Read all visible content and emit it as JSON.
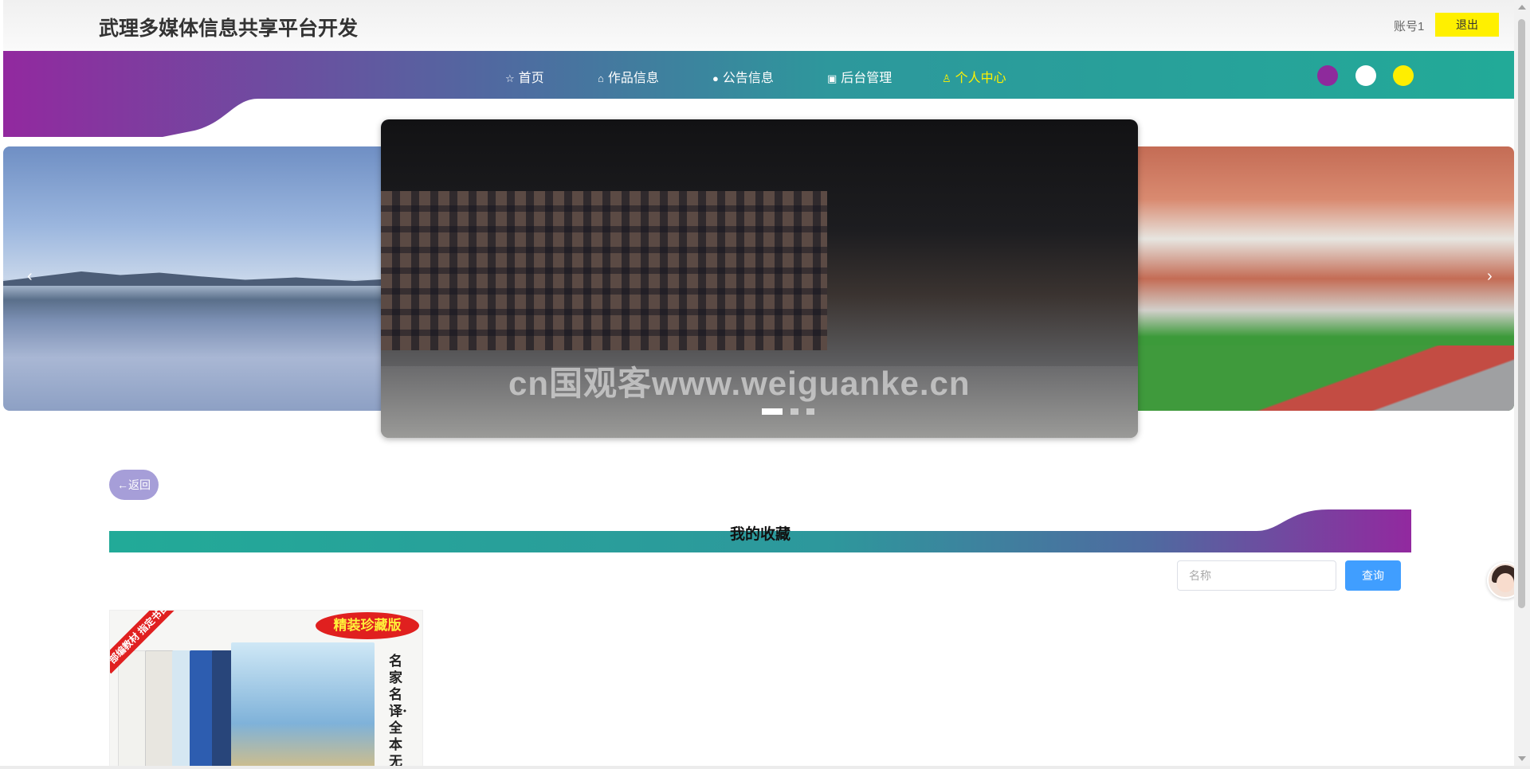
{
  "header": {
    "title": "武理多媒体信息共享平台开发",
    "account_label": "账号1",
    "logout_label": "退出"
  },
  "nav": {
    "items": [
      {
        "label": "首页",
        "icon": "star-icon",
        "glyph": "☆"
      },
      {
        "label": "作品信息",
        "icon": "bag-icon",
        "glyph": "⌂"
      },
      {
        "label": "公告信息",
        "icon": "info-icon",
        "glyph": "●"
      },
      {
        "label": "后台管理",
        "icon": "box-icon",
        "glyph": "▣"
      },
      {
        "label": "个人中心",
        "icon": "user-icon",
        "glyph": "♙",
        "active": true
      }
    ],
    "active_color": "#fff200",
    "gradient": [
      "#8f2a9e",
      "#22a99a"
    ]
  },
  "theme_dots": [
    "#8e2a9c",
    "#ffffff",
    "#ffee00"
  ],
  "carousel": {
    "watermark": "cn国观客www.weiguanke.cn",
    "active_index": 0,
    "slide_count": 3,
    "prev_label": "‹",
    "next_label": "›"
  },
  "content": {
    "back_label": "←返回",
    "section_title": "我的收藏",
    "search": {
      "placeholder": "名称",
      "button_label": "查询"
    },
    "cards": [
      {
        "ribbon": "部编教材 指定书目",
        "badge": "精装珍藏版",
        "vertical_text": "名家名译·全本无删减"
      }
    ]
  }
}
